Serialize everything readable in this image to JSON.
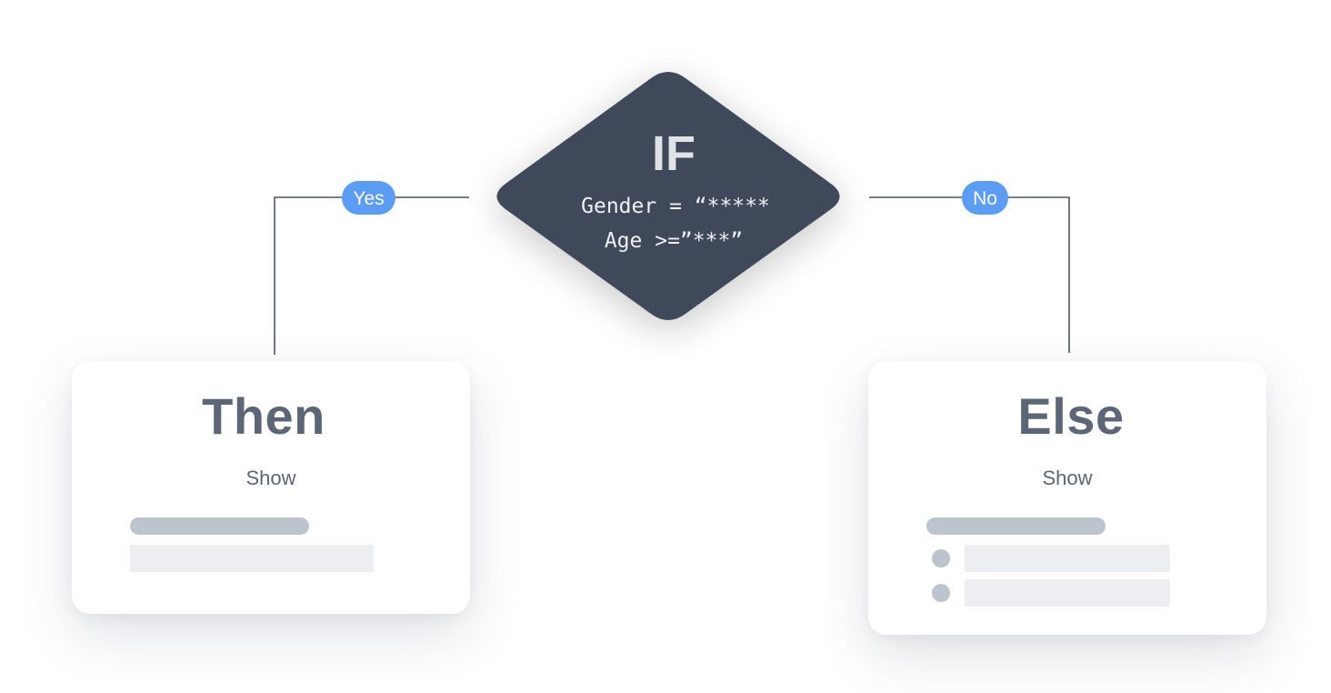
{
  "decision": {
    "title": "IF",
    "condition_line1": "Gender = “*****",
    "condition_line2": "Age >=”***”"
  },
  "branches": {
    "yes_label": "Yes",
    "no_label": "No"
  },
  "then_card": {
    "title": "Then",
    "subtitle": "Show"
  },
  "else_card": {
    "title": "Else",
    "subtitle": "Show"
  },
  "colors": {
    "diamond": "#3f4a5a",
    "diamond_text": "#eef0f3",
    "branch_pill": "#5b9cf5",
    "connector": "#4b5563",
    "card_text": "#5d6677",
    "placeholder_dark": "#bcc4cd",
    "placeholder_light": "#eceef1"
  }
}
